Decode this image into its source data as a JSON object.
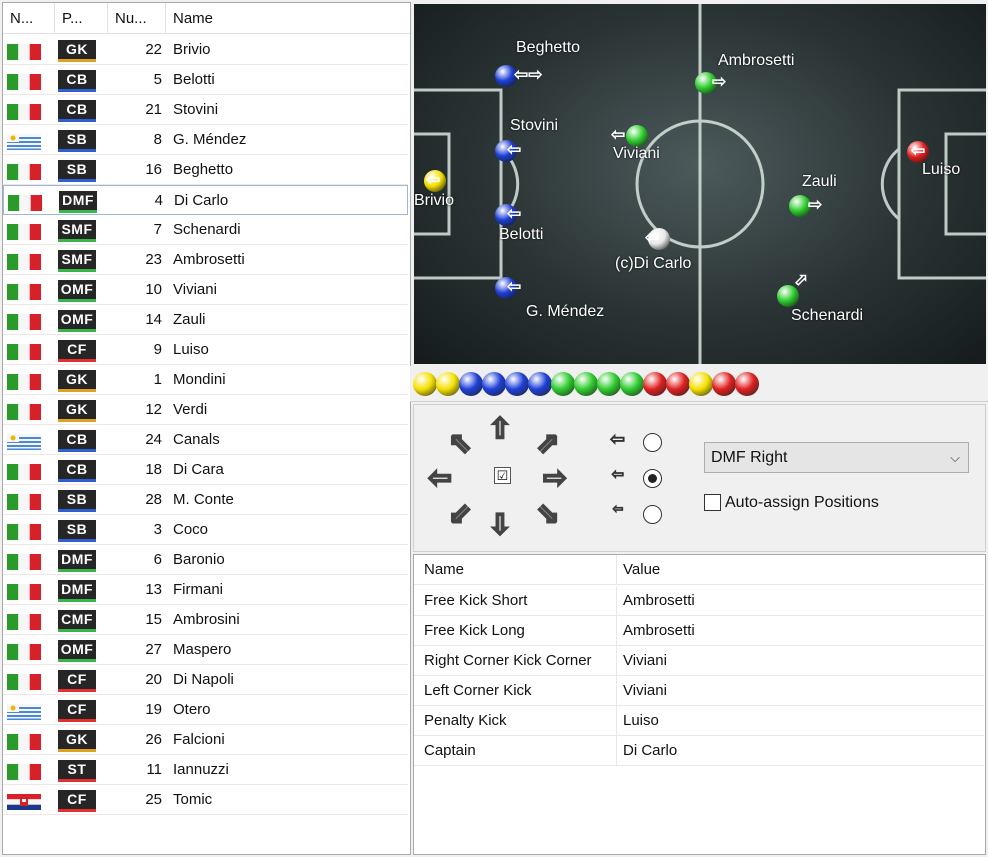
{
  "roster": {
    "columns": [
      "N...",
      "P...",
      "Nu...",
      "Name"
    ],
    "rows": [
      {
        "flag": "italy",
        "pos": "GK",
        "num": "22",
        "name": "Brivio"
      },
      {
        "flag": "italy",
        "pos": "CB",
        "num": "5",
        "name": "Belotti"
      },
      {
        "flag": "italy",
        "pos": "CB",
        "num": "21",
        "name": "Stovini"
      },
      {
        "flag": "uruguay",
        "pos": "SB",
        "num": "8",
        "name": "G. Méndez"
      },
      {
        "flag": "italy",
        "pos": "SB",
        "num": "16",
        "name": "Beghetto"
      },
      {
        "flag": "italy",
        "pos": "DMF",
        "num": "4",
        "name": "Di Carlo"
      },
      {
        "flag": "italy",
        "pos": "SMF",
        "num": "7",
        "name": "Schenardi"
      },
      {
        "flag": "italy",
        "pos": "SMF",
        "num": "23",
        "name": "Ambrosetti"
      },
      {
        "flag": "italy",
        "pos": "OMF",
        "num": "10",
        "name": "Viviani"
      },
      {
        "flag": "italy",
        "pos": "OMF",
        "num": "14",
        "name": "Zauli"
      },
      {
        "flag": "italy",
        "pos": "CF",
        "num": "9",
        "name": "Luiso"
      },
      {
        "flag": "italy",
        "pos": "GK",
        "num": "1",
        "name": "Mondini"
      },
      {
        "flag": "italy",
        "pos": "GK",
        "num": "12",
        "name": "Verdi"
      },
      {
        "flag": "uruguay",
        "pos": "CB",
        "num": "24",
        "name": "Canals"
      },
      {
        "flag": "italy",
        "pos": "CB",
        "num": "18",
        "name": "Di Cara"
      },
      {
        "flag": "italy",
        "pos": "SB",
        "num": "28",
        "name": "M. Conte"
      },
      {
        "flag": "italy",
        "pos": "SB",
        "num": "3",
        "name": "Coco"
      },
      {
        "flag": "italy",
        "pos": "DMF",
        "num": "6",
        "name": "Baronio"
      },
      {
        "flag": "italy",
        "pos": "DMF",
        "num": "13",
        "name": "Firmani"
      },
      {
        "flag": "italy",
        "pos": "CMF",
        "num": "15",
        "name": "Ambrosini"
      },
      {
        "flag": "italy",
        "pos": "OMF",
        "num": "27",
        "name": "Maspero"
      },
      {
        "flag": "italy",
        "pos": "CF",
        "num": "20",
        "name": "Di Napoli"
      },
      {
        "flag": "uruguay",
        "pos": "CF",
        "num": "19",
        "name": "Otero"
      },
      {
        "flag": "italy",
        "pos": "GK",
        "num": "26",
        "name": "Falcioni"
      },
      {
        "flag": "italy",
        "pos": "ST",
        "num": "11",
        "name": "Iannuzzi"
      },
      {
        "flag": "croatia",
        "pos": "CF",
        "num": "25",
        "name": "Tomic"
      }
    ],
    "selected_row": 5
  },
  "position_colors": {
    "GK": "#e0a020",
    "CB": "#2f5fd0",
    "SB": "#2f5fd0",
    "DMF": "#39b54a",
    "SMF": "#39b54a",
    "CMF": "#39b54a",
    "OMF": "#39b54a",
    "CF": "#e03030",
    "ST": "#e03030"
  },
  "ball_colors": {
    "yellow": "#f4e000",
    "blue": "#1e3fd8",
    "green": "#2ecc2e",
    "red": "#e02020",
    "white": "#e8e8e8"
  },
  "pitch": {
    "players": [
      {
        "name": "Beghetto",
        "color": "blue",
        "arrow": "⇦⇨"
      },
      {
        "name": "Ambrosetti",
        "color": "green",
        "arrow": "⇨"
      },
      {
        "name": "Stovini",
        "color": "blue",
        "arrow": "⇦"
      },
      {
        "name": "Viviani",
        "color": "green",
        "arrow": "⇦"
      },
      {
        "name": "Brivio",
        "color": "yellow",
        "arrow": "⇦"
      },
      {
        "name": "Luiso",
        "color": "red",
        "arrow": "⇦"
      },
      {
        "name": "Zauli",
        "color": "green",
        "arrow": "⇨"
      },
      {
        "name": "Belotti",
        "color": "blue",
        "arrow": "⇦"
      },
      {
        "name": "(c)Di Carlo",
        "color": "white",
        "arrow": "⇦"
      },
      {
        "name": "G. Méndez",
        "color": "blue",
        "arrow": "⇦"
      },
      {
        "name": "Schenardi",
        "color": "green",
        "arrow": "⬀"
      }
    ]
  },
  "strip_balls": [
    "yellow",
    "yellow",
    "blue",
    "blue",
    "blue",
    "blue",
    "green",
    "green",
    "green",
    "green",
    "red",
    "red",
    "yellow",
    "red",
    "red"
  ],
  "controls": {
    "directions": [
      "⇖",
      "⇧",
      "⇗",
      "⇦",
      "⇨",
      "⇙",
      "⇩",
      "⇘"
    ],
    "active_direction": "⇦",
    "center_check": "☑",
    "speed_options": [
      "slow",
      "medium",
      "fast"
    ],
    "speed_selected": 1,
    "side_select": "DMF Right",
    "side_chevron": "⌵",
    "auto_assign_label": "Auto-assign Positions"
  },
  "props": {
    "headers": [
      "Name",
      "Value"
    ],
    "rows": [
      {
        "name": "Free Kick Short",
        "value": "Ambrosetti"
      },
      {
        "name": "Free Kick Long",
        "value": "Ambrosetti"
      },
      {
        "name": "Right Corner Kick Corner",
        "value": "Viviani"
      },
      {
        "name": "Left Corner Kick",
        "value": "Viviani"
      },
      {
        "name": "Penalty Kick",
        "value": "Luiso"
      },
      {
        "name": "Captain",
        "value": "Di Carlo"
      }
    ]
  }
}
